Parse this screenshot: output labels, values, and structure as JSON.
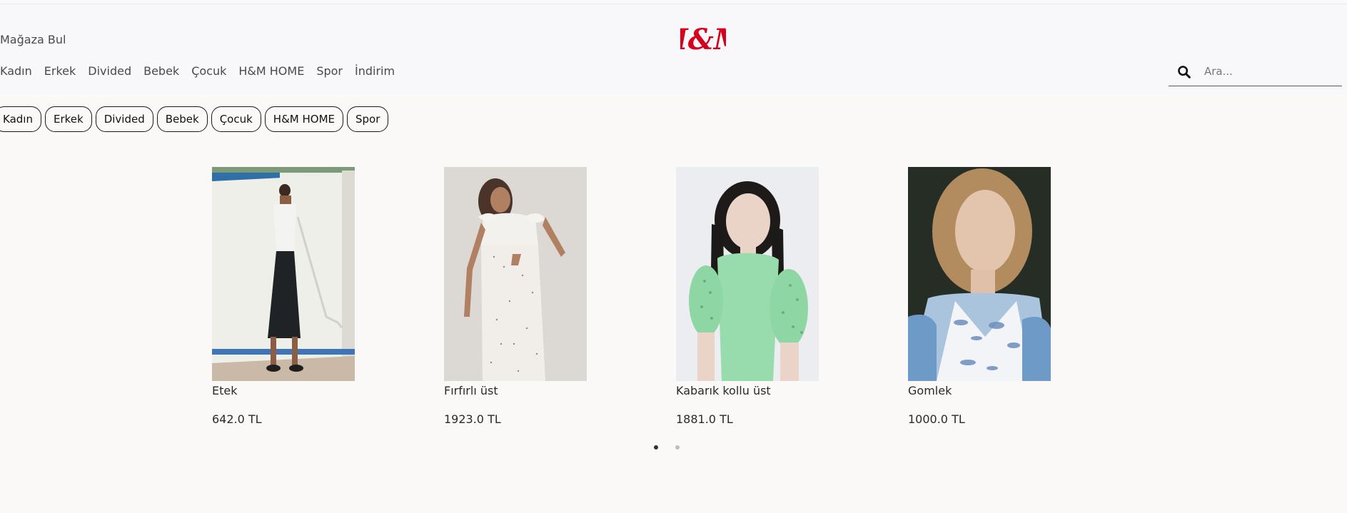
{
  "header": {
    "store_finder": "Mağaza Bul",
    "logo_text": "H&M",
    "brand_color": "#d6001c",
    "nav": [
      "Kadın",
      "Erkek",
      "Divided",
      "Bebek",
      "Çocuk",
      "H&M HOME",
      "Spor",
      "İndirim"
    ],
    "search": {
      "placeholder": "Ara...",
      "value": "",
      "icon": "search-icon"
    }
  },
  "category_chips": [
    "Kadın",
    "Erkek",
    "Divided",
    "Bebek",
    "Çocuk",
    "H&M HOME",
    "Spor"
  ],
  "products": [
    {
      "name": "Etek",
      "price": "642.0 TL"
    },
    {
      "name": "Fırfırlı üst",
      "price": "1923.0 TL"
    },
    {
      "name": "Kabarık kollu üst",
      "price": "1881.0 TL"
    },
    {
      "name": "Gomlek",
      "price": "1000.0 TL"
    }
  ],
  "carousel": {
    "page_count": 2,
    "active_page": 1
  }
}
